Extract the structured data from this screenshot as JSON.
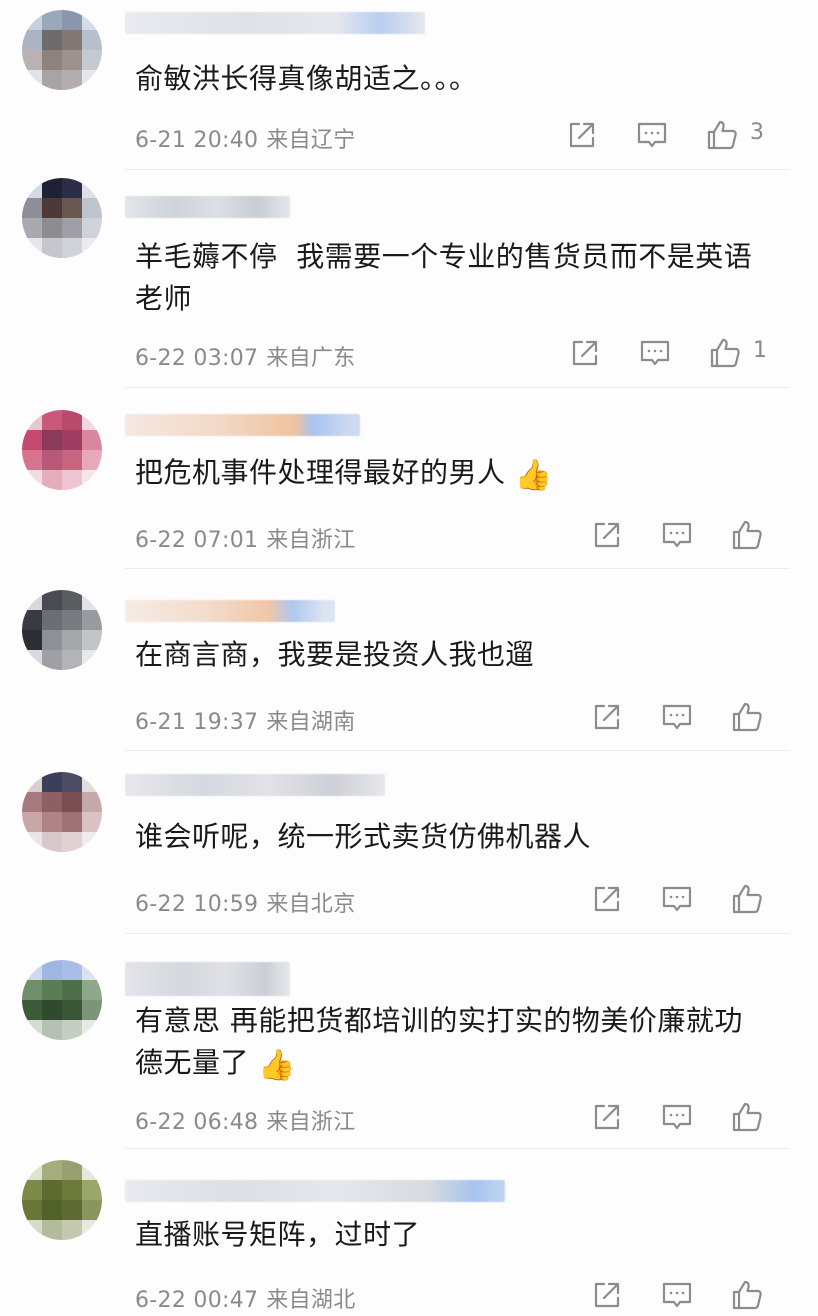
{
  "colors": {
    "text": "#1a1a1a",
    "meta": "#8a8a8a",
    "icon": "#8c8c8c",
    "divider": "#ececf0",
    "background": "#fdfdfe"
  },
  "icons": {
    "share": "share-icon",
    "comment": "comment-icon",
    "like": "thumb-up-icon",
    "emoji": "thumbs-up-emoji"
  },
  "comments": [
    {
      "text": "俞敏洪长得真像胡适之。。。",
      "date": "6-21 20:40",
      "location": "来自辽宁",
      "likes": "3"
    },
    {
      "text": "羊毛薅不停  我需要一个专业的售货员而不是英语老师",
      "date": "6-22 03:07",
      "location": "来自广东",
      "likes": "1"
    },
    {
      "text": "把危机事件处理得最好的男人",
      "emoji": "👍",
      "date": "6-22 07:01",
      "location": "来自浙江",
      "likes": ""
    },
    {
      "text": "在商言商，我要是投资人我也遛",
      "date": "6-21 19:37",
      "location": "来自湖南",
      "likes": ""
    },
    {
      "text": "谁会听呢，统一形式卖货仿佛机器人",
      "date": "6-22 10:59",
      "location": "来自北京",
      "likes": ""
    },
    {
      "text": "有意思 再能把货都培训的实打实的物美价廉就功德无量了",
      "emoji": "👍",
      "date": "6-22 06:48",
      "location": "来自浙江",
      "likes": ""
    },
    {
      "text": "直播账号矩阵，过时了",
      "date": "6-22 00:47",
      "location": "来自湖北",
      "likes": ""
    }
  ]
}
